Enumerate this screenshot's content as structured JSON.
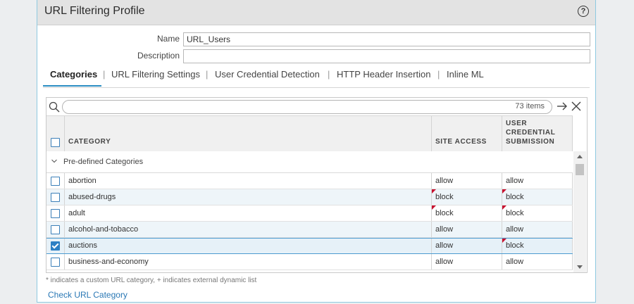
{
  "dialog": {
    "title": "URL Filtering Profile",
    "help": "?"
  },
  "form": {
    "name_label": "Name",
    "name_value": "URL_Users",
    "description_label": "Description",
    "description_value": ""
  },
  "tabs": [
    {
      "label": "Categories",
      "active": true
    },
    {
      "label": "URL Filtering Settings",
      "active": false
    },
    {
      "label": "User Credential Detection",
      "active": false
    },
    {
      "label": "HTTP Header Insertion",
      "active": false
    },
    {
      "label": "Inline ML",
      "active": false
    }
  ],
  "separator": "|",
  "grid": {
    "items_count": "73 items",
    "columns": {
      "category": "CATEGORY",
      "site_access": "SITE ACCESS",
      "user_credential_line1": "USER",
      "user_credential_line2": "CREDENTIAL",
      "user_credential_line3": "SUBMISSION"
    },
    "group_label": "Pre-defined Categories",
    "rows": [
      {
        "category": "abortion",
        "site_access": "allow",
        "user_credential": "allow",
        "site_flag": false,
        "cred_flag": false,
        "checked": false
      },
      {
        "category": "abused-drugs",
        "site_access": "block",
        "user_credential": "block",
        "site_flag": true,
        "cred_flag": true,
        "checked": false
      },
      {
        "category": "adult",
        "site_access": "block",
        "user_credential": "block",
        "site_flag": true,
        "cred_flag": true,
        "checked": false
      },
      {
        "category": "alcohol-and-tobacco",
        "site_access": "allow",
        "user_credential": "allow",
        "site_flag": false,
        "cred_flag": false,
        "checked": false
      },
      {
        "category": "auctions",
        "site_access": "allow",
        "user_credential": "block",
        "site_flag": false,
        "cred_flag": true,
        "checked": true
      },
      {
        "category": "business-and-economy",
        "site_access": "allow",
        "user_credential": "allow",
        "site_flag": false,
        "cred_flag": false,
        "checked": false
      }
    ]
  },
  "footnote": "* indicates a custom URL category, + indicates external dynamic list",
  "check_link": "Check URL Category",
  "colors": {
    "accent": "#2a8dc2",
    "link": "#2a78b5",
    "flag": "#c8102e",
    "selected_border": "#4b9bd0"
  }
}
